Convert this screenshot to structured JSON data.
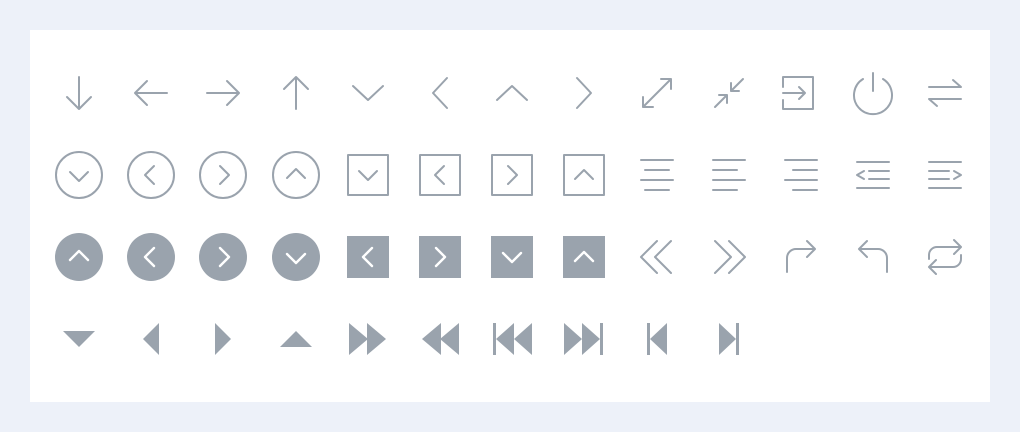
{
  "colors": {
    "background": "#edf1f9",
    "panel": "#ffffff",
    "icon": "#9aa3ad"
  },
  "rows": [
    [
      "arrow-down-icon",
      "arrow-left-icon",
      "arrow-right-icon",
      "arrow-up-icon",
      "chevron-down-icon",
      "chevron-left-icon",
      "chevron-up-icon",
      "chevron-right-icon",
      "expand-icon",
      "collapse-icon",
      "sign-in-icon",
      "power-icon",
      "swap-horizontal-icon"
    ],
    [
      "chevron-down-circle-icon",
      "chevron-left-circle-icon",
      "chevron-right-circle-icon",
      "chevron-up-circle-icon",
      "chevron-down-square-icon",
      "chevron-left-square-icon",
      "chevron-right-square-icon",
      "chevron-up-square-icon",
      "align-center-icon",
      "align-left-icon",
      "align-right-icon",
      "indent-decrease-icon",
      "indent-increase-icon"
    ],
    [
      "chevron-up-circle-filled-icon",
      "chevron-left-circle-filled-icon",
      "chevron-right-circle-filled-icon",
      "chevron-down-circle-filled-icon",
      "chevron-left-square-filled-icon",
      "chevron-right-square-filled-icon",
      "chevron-down-square-filled-icon",
      "chevron-up-square-filled-icon",
      "double-chevron-left-icon",
      "double-chevron-right-icon",
      "redo-icon",
      "undo-icon",
      "repeat-icon"
    ],
    [
      "caret-down-icon",
      "caret-left-icon",
      "caret-right-icon",
      "caret-up-icon",
      "fast-forward-icon",
      "rewind-icon",
      "skip-back-icon",
      "skip-forward-icon",
      "step-backward-icon",
      "step-forward-icon"
    ]
  ]
}
